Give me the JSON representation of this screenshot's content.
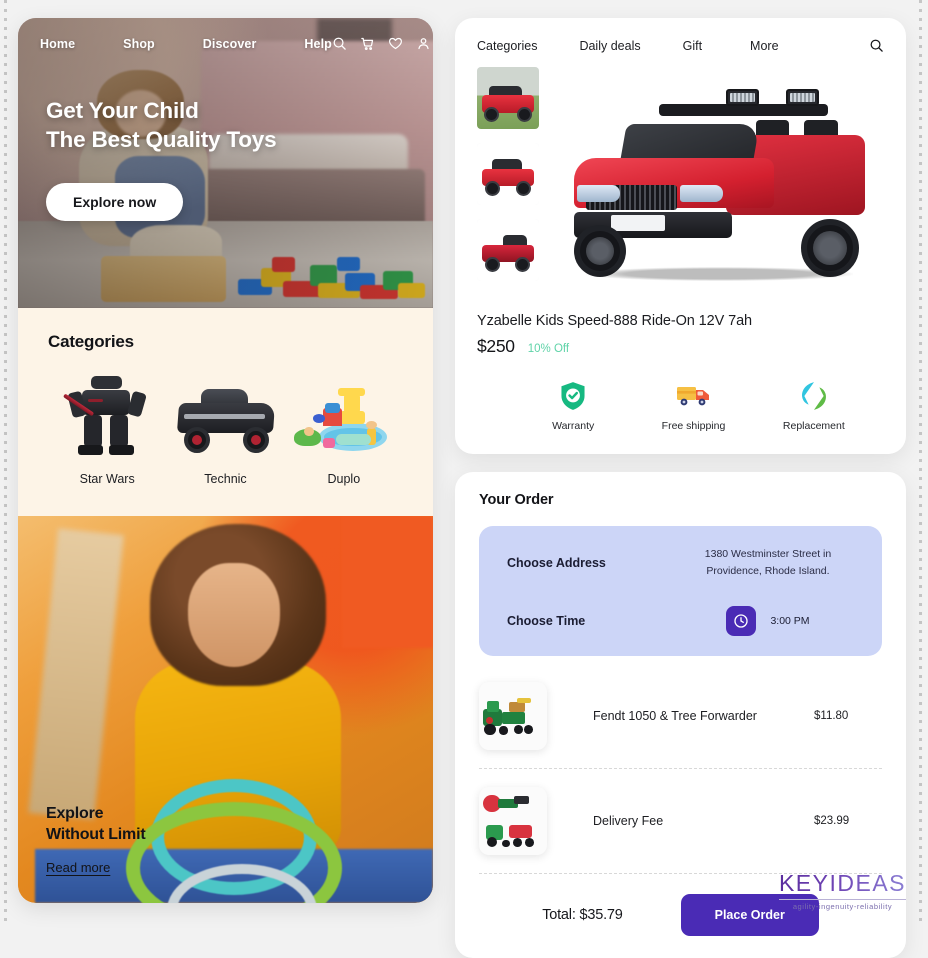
{
  "site": {
    "nav": [
      {
        "label": "Home"
      },
      {
        "label": "Shop"
      },
      {
        "label": "Discover"
      },
      {
        "label": "Help"
      }
    ],
    "nav_icons": [
      {
        "name": "search-icon"
      },
      {
        "name": "cart-icon"
      },
      {
        "name": "heart-icon"
      },
      {
        "name": "account-icon"
      }
    ]
  },
  "hero": {
    "headline_line1": "Get Your Child",
    "headline_line2": "The Best Quality Toys",
    "cta_label": "Explore now"
  },
  "categories": {
    "title": "Categories",
    "items": [
      {
        "label": "Star Wars",
        "image": "star-wars-mech-figure"
      },
      {
        "label": "Technic",
        "image": "technic-black-race-car"
      },
      {
        "label": "Duplo",
        "image": "duplo-water-park-playset"
      }
    ]
  },
  "promo": {
    "headline_line1": "Explore",
    "headline_line2": "Without Limit",
    "link_label": "Read more",
    "image": "smiling-girl-yellow-shirt-with-stacking-rings"
  },
  "product": {
    "tabs": [
      {
        "label": "Categories"
      },
      {
        "label": "Daily deals"
      },
      {
        "label": "Gift"
      },
      {
        "label": "More"
      }
    ],
    "search_icon": "search-icon",
    "thumbnails": [
      {
        "name": "ride-on-jeep-front-outdoor"
      },
      {
        "name": "ride-on-jeep-front-angle"
      },
      {
        "name": "ride-on-jeep-rear-angle"
      }
    ],
    "main_image": "red-ride-on-jeep-front-three-quarter",
    "title": "Yzabelle Kids Speed-888 Ride-On 12V 7ah",
    "price": "$250",
    "discount": "10% Off",
    "discount_color": "#5fd3a8",
    "badges": [
      {
        "label": "Warranty",
        "icon": "shield-check-icon"
      },
      {
        "label": "Free shipping",
        "icon": "delivery-truck-icon"
      },
      {
        "label": "Replacement",
        "icon": "replacement-arrows-icon"
      }
    ]
  },
  "order": {
    "title": "Your Order",
    "address_label": "Choose Address",
    "address_value": "1380 Westminster Street in Providence, Rhode Island.",
    "time_label": "Choose Time",
    "time_value": "3:00 PM",
    "time_icon": "clock-icon",
    "accent_color": "#4a2bb5",
    "panel_color": "#ccd5f7",
    "items": [
      {
        "name": "Fendt 1050 & Tree Forwarder",
        "price": "$11.80",
        "image": "green-tractor-with-log-trailer"
      },
      {
        "name": "Delivery Fee",
        "price": "$23.99",
        "image": "tractor-with-red-and-green-implements"
      }
    ],
    "total_label": "Total: $35.79",
    "place_order_label": "Place Order"
  },
  "footer": {
    "logo_word": "KEYIDEAS",
    "logo_tagline": "agility-ingenuity-reliability"
  }
}
